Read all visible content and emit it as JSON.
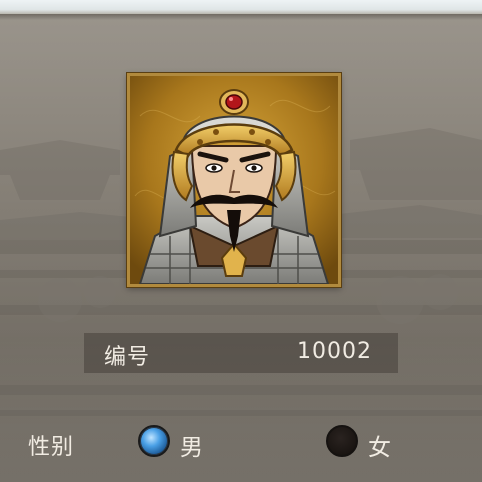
{
  "profile": {
    "id_label": "编号",
    "id_value": "10002"
  },
  "gender": {
    "label": "性别",
    "options": [
      {
        "label": "男",
        "selected": true
      },
      {
        "label": "女",
        "selected": false
      }
    ]
  },
  "colors": {
    "frame_gold": "#b18a3d",
    "radio_selected_blue": "#4aa0e6",
    "text_light": "#f1ece3"
  },
  "icons": {
    "portrait": "general-portrait-icon"
  }
}
